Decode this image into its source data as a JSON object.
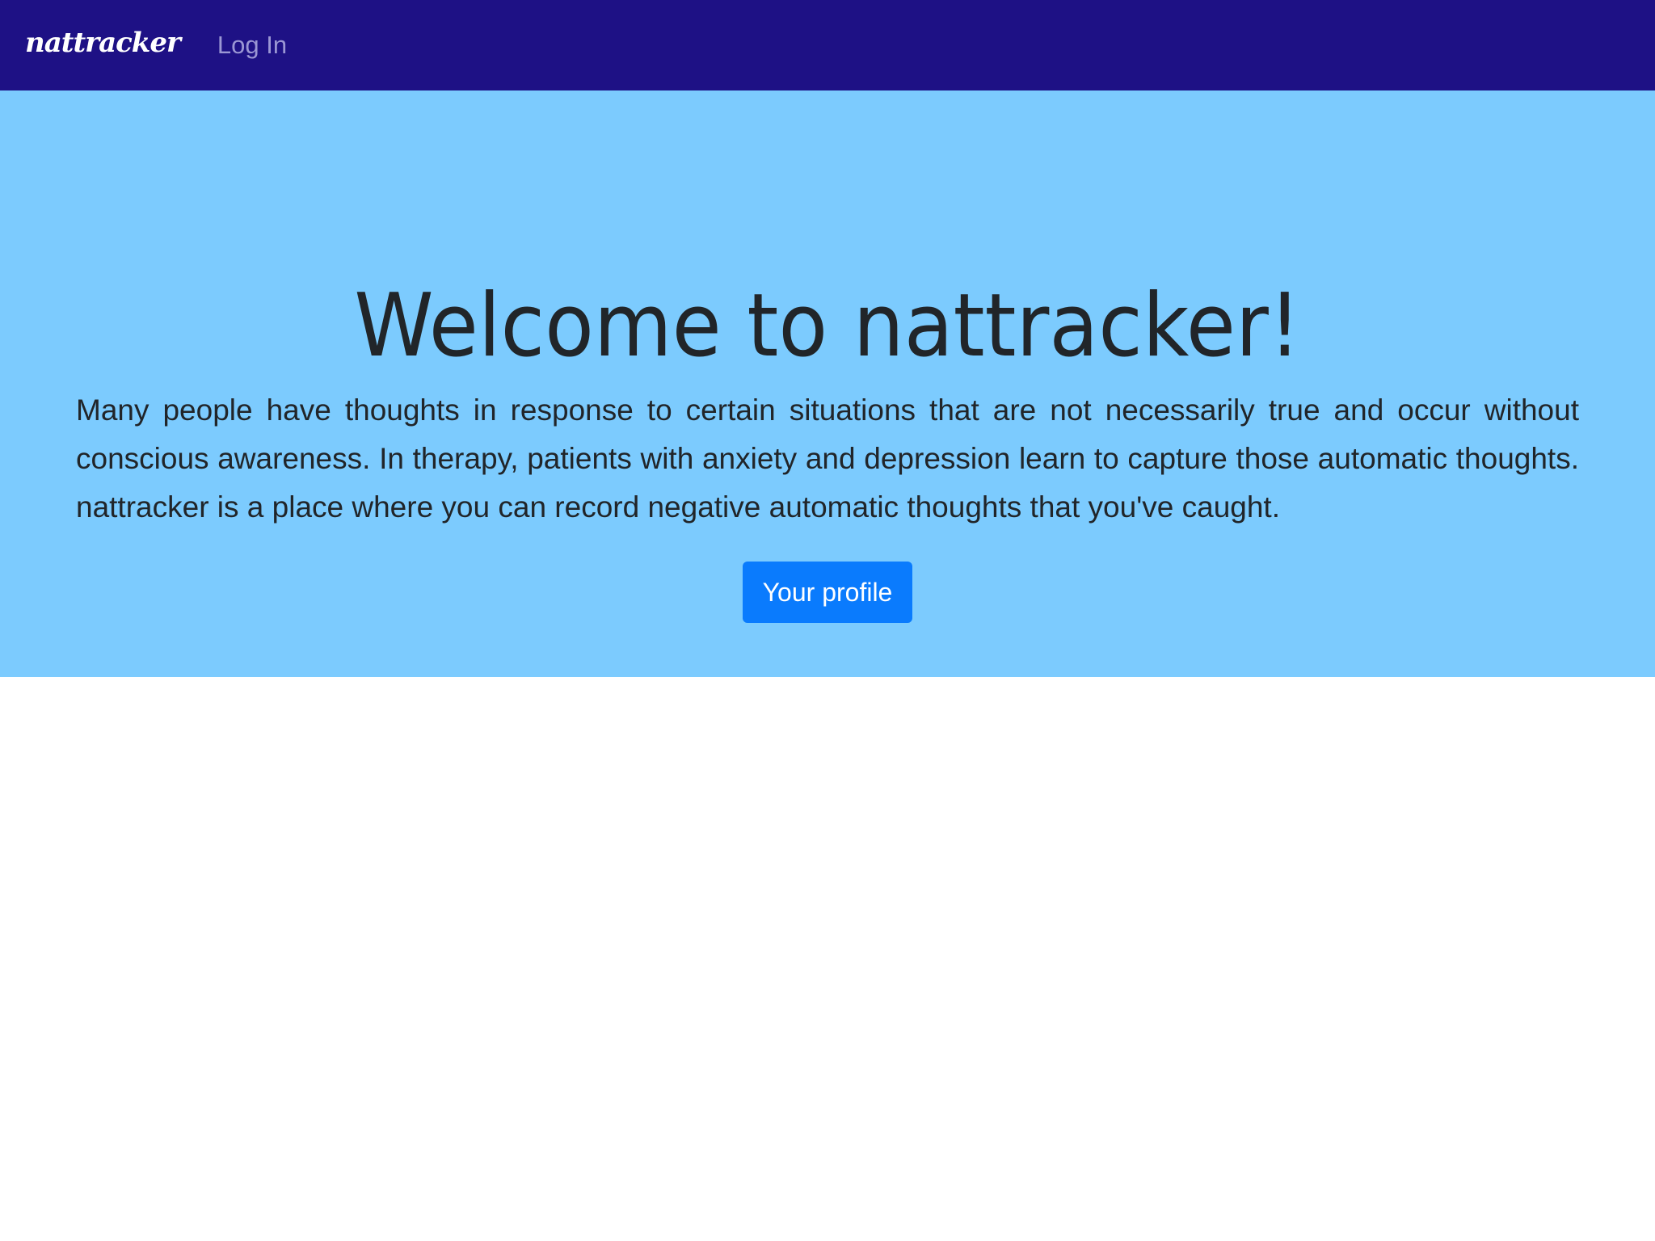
{
  "navbar": {
    "brand": "nattracker",
    "login_label": "Log In",
    "background": "#1e1185"
  },
  "hero": {
    "title": "Welcome to nattracker!",
    "description": "Many people have thoughts in response to certain situations that are not necessarily true and occur without conscious awareness. In therapy, patients with anxiety and depression learn to capture those automatic thoughts. nattracker is a place where you can record negative automatic thoughts that you've caught.",
    "button_label": "Your profile",
    "background": "#7ccbfe",
    "button_color": "#0a7bfd"
  }
}
